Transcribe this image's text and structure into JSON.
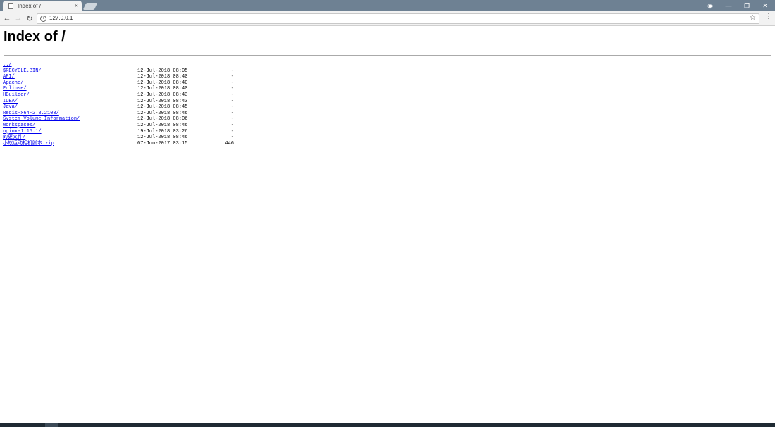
{
  "browser": {
    "tab_title": "Index of /",
    "tab_close": "×",
    "url": "127.0.0.1",
    "back_glyph": "←",
    "forward_glyph": "→",
    "reload_glyph": "↻",
    "info_glyph": "i",
    "star_glyph": "☆",
    "menu_glyph": "⋮",
    "profile_glyph": "◉",
    "minimize_glyph": "—",
    "restore_glyph": "❐",
    "close_glyph": "✕"
  },
  "page": {
    "heading": "Index of /",
    "entries": [
      {
        "name": "../",
        "date": "",
        "size": ""
      },
      {
        "name": "$RECYCLE.BIN/",
        "date": "12-Jul-2018 08:05",
        "size": "-"
      },
      {
        "name": "API/",
        "date": "12-Jul-2018 08:40",
        "size": "-"
      },
      {
        "name": "Apache/",
        "date": "12-Jul-2018 08:40",
        "size": "-"
      },
      {
        "name": "Eclipse/",
        "date": "12-Jul-2018 08:40",
        "size": "-"
      },
      {
        "name": "HBuilder/",
        "date": "12-Jul-2018 08:43",
        "size": "-"
      },
      {
        "name": "IDEA/",
        "date": "12-Jul-2018 08:43",
        "size": "-"
      },
      {
        "name": "Java/",
        "date": "12-Jul-2018 08:45",
        "size": "-"
      },
      {
        "name": "Redis-x64-2.8.2103/",
        "date": "12-Jul-2018 08:46",
        "size": "-"
      },
      {
        "name": "System Volume Information/",
        "date": "12-Jul-2018 08:06",
        "size": "-"
      },
      {
        "name": "Workspaces/",
        "date": "12-Jul-2018 08:46",
        "size": "-"
      },
      {
        "name": "nginx-1.15.1/",
        "date": "19-Jul-2018 03:26",
        "size": "-"
      },
      {
        "name": "的更文件/",
        "date": "12-Jul-2018 08:46",
        "size": "-"
      },
      {
        "name": "小蚁运动相机脚本.zip",
        "date": "07-Jun-2017 03:15",
        "size": "446"
      }
    ]
  },
  "colors": {
    "tabstrip": "#6e8193",
    "link": "#0000ee",
    "rule": "#aaaaaa"
  }
}
